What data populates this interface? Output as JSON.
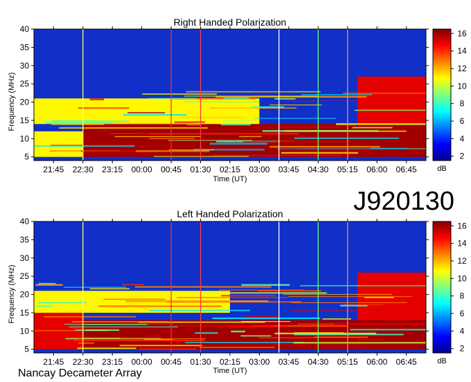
{
  "figure": {
    "id_label": "J920130",
    "footer": "Nancay Decameter Array"
  },
  "chart_data": [
    {
      "type": "heatmap",
      "title": "Right Handed Polarization",
      "xlabel": "Time (UT)",
      "ylabel": "Frequency (MHz)",
      "x_ticks": [
        "21:45",
        "22:30",
        "23:15",
        "00:00",
        "00:45",
        "01:30",
        "02:15",
        "03:00",
        "03:45",
        "04:30",
        "05:15",
        "06:00",
        "06:45"
      ],
      "y_ticks": [
        5,
        10,
        15,
        20,
        25,
        30,
        35,
        40
      ],
      "ylim": [
        4,
        40
      ],
      "xlim": [
        "21:15",
        "07:15"
      ],
      "colorbar": {
        "label": "dB",
        "ticks": [
          2,
          4,
          6,
          8,
          10,
          12,
          14,
          16
        ],
        "range": [
          1.5,
          16.5
        ]
      },
      "markers_ut": [
        {
          "time": "22:30",
          "color": "#ffff66"
        },
        {
          "time": "00:45",
          "color": "#ff2a2a"
        },
        {
          "time": "01:30",
          "color": "#ff3c3c"
        },
        {
          "time": "03:30",
          "color": "#ffffff"
        },
        {
          "time": "04:30",
          "color": "#66ff66"
        },
        {
          "time": "05:15",
          "color": "#ff9040"
        }
      ],
      "intensity_regions": [
        {
          "from": "22:30",
          "to": "07:15",
          "f_low": 5,
          "f_high": 14,
          "level_db": 16
        },
        {
          "from": "21:15",
          "to": "22:30",
          "f_low": 5,
          "f_high": 12,
          "level_db": 11
        },
        {
          "from": "21:15",
          "to": "03:00",
          "f_low": 14,
          "f_high": 21,
          "level_db": 11
        },
        {
          "from": "05:30",
          "to": "07:15",
          "f_low": 14,
          "f_high": 27,
          "level_db": 15
        }
      ]
    },
    {
      "type": "heatmap",
      "title": "Left Handed Polarization",
      "xlabel": "Time (UT)",
      "ylabel": "Frequency (MHz)",
      "x_ticks": [
        "21:45",
        "22:30",
        "23:15",
        "00:00",
        "00:45",
        "01:30",
        "02:15",
        "03:00",
        "03:45",
        "04:30",
        "05:15",
        "06:00",
        "06:45"
      ],
      "y_ticks": [
        5,
        10,
        15,
        20,
        25,
        30,
        35,
        40
      ],
      "ylim": [
        4,
        40
      ],
      "xlim": [
        "21:15",
        "07:15"
      ],
      "colorbar": {
        "label": "dB",
        "ticks": [
          2,
          4,
          6,
          8,
          10,
          12,
          14,
          16
        ],
        "range": [
          1.5,
          16.5
        ]
      },
      "markers_ut": [
        {
          "time": "22:30",
          "color": "#ffff66"
        },
        {
          "time": "00:45",
          "color": "#ff2a2a"
        },
        {
          "time": "01:30",
          "color": "#ff3c3c"
        },
        {
          "time": "03:30",
          "color": "#ffffff"
        },
        {
          "time": "04:30",
          "color": "#66ff66"
        },
        {
          "time": "05:15",
          "color": "#ff9040"
        }
      ],
      "intensity_regions": [
        {
          "from": "22:30",
          "to": "07:15",
          "f_low": 5,
          "f_high": 13,
          "level_db": 16
        },
        {
          "from": "21:15",
          "to": "22:30",
          "f_low": 5,
          "f_high": 15,
          "level_db": 15
        },
        {
          "from": "21:15",
          "to": "02:15",
          "f_low": 15,
          "f_high": 21,
          "level_db": 11
        },
        {
          "from": "05:30",
          "to": "07:15",
          "f_low": 13,
          "f_high": 26,
          "level_db": 15
        }
      ]
    }
  ]
}
